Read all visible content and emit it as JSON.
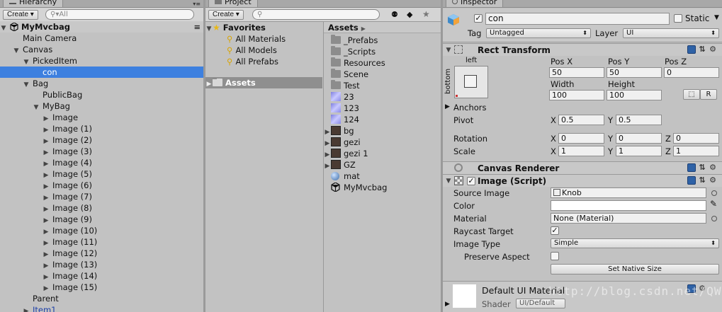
{
  "colors": {
    "selection": "#3d80df",
    "panel": "#c2c2c2",
    "book_icon": "#2f62a6"
  },
  "hierarchy": {
    "tab": "Hierarchy",
    "create": "Create",
    "search_placeholder": "All",
    "scene": "MyMvcbag",
    "items": [
      {
        "label": "Main Camera",
        "indent": 1,
        "arrow": ""
      },
      {
        "label": "Canvas",
        "indent": 1,
        "arrow": "▼"
      },
      {
        "label": "PickedItem",
        "indent": 2,
        "arrow": "▼"
      },
      {
        "label": "con",
        "indent": 3,
        "arrow": "",
        "selected": true
      },
      {
        "label": "Bag",
        "indent": 2,
        "arrow": "▼"
      },
      {
        "label": "PublicBag",
        "indent": 3,
        "arrow": ""
      },
      {
        "label": "MyBag",
        "indent": 3,
        "arrow": "▼"
      },
      {
        "label": "Image",
        "indent": 4,
        "arrow": "▶"
      },
      {
        "label": "Image (1)",
        "indent": 4,
        "arrow": "▶"
      },
      {
        "label": "Image (2)",
        "indent": 4,
        "arrow": "▶"
      },
      {
        "label": "Image (3)",
        "indent": 4,
        "arrow": "▶"
      },
      {
        "label": "Image (4)",
        "indent": 4,
        "arrow": "▶"
      },
      {
        "label": "Image (5)",
        "indent": 4,
        "arrow": "▶"
      },
      {
        "label": "Image (6)",
        "indent": 4,
        "arrow": "▶"
      },
      {
        "label": "Image (7)",
        "indent": 4,
        "arrow": "▶"
      },
      {
        "label": "Image (8)",
        "indent": 4,
        "arrow": "▶"
      },
      {
        "label": "Image (9)",
        "indent": 4,
        "arrow": "▶"
      },
      {
        "label": "Image (10)",
        "indent": 4,
        "arrow": "▶"
      },
      {
        "label": "Image (11)",
        "indent": 4,
        "arrow": "▶"
      },
      {
        "label": "Image (12)",
        "indent": 4,
        "arrow": "▶"
      },
      {
        "label": "Image (13)",
        "indent": 4,
        "arrow": "▶"
      },
      {
        "label": "Image (14)",
        "indent": 4,
        "arrow": "▶"
      },
      {
        "label": "Image (15)",
        "indent": 4,
        "arrow": "▶"
      },
      {
        "label": "Parent",
        "indent": 2,
        "arrow": ""
      },
      {
        "label": "Item1",
        "indent": 2,
        "arrow": "▶",
        "prefab": true
      }
    ]
  },
  "project": {
    "tab": "Project",
    "create": "Create",
    "favorites_label": "Favorites",
    "favorites": [
      "All Materials",
      "All Models",
      "All Prefabs"
    ],
    "assets_left_label": "Assets",
    "breadcrumb": "Assets",
    "assets": [
      {
        "label": "_Prefabs",
        "icon": "folder-icon",
        "arrow": ""
      },
      {
        "label": "_Scripts",
        "icon": "folder-icon",
        "arrow": ""
      },
      {
        "label": "Resources",
        "icon": "folder-icon",
        "arrow": ""
      },
      {
        "label": "Scene",
        "icon": "folder-icon",
        "arrow": ""
      },
      {
        "label": "Test",
        "icon": "folder-icon",
        "arrow": ""
      },
      {
        "label": "23",
        "icon": "texture-icon",
        "arrow": ""
      },
      {
        "label": "123",
        "icon": "texture-icon",
        "arrow": ""
      },
      {
        "label": "124",
        "icon": "texture-icon",
        "arrow": ""
      },
      {
        "label": "bg",
        "icon": "sprite-icon",
        "arrow": "▶"
      },
      {
        "label": "gezi",
        "icon": "sprite-icon",
        "arrow": "▶"
      },
      {
        "label": "gezi 1",
        "icon": "sprite-icon",
        "arrow": "▶"
      },
      {
        "label": "GZ",
        "icon": "sprite-icon",
        "arrow": "▶"
      },
      {
        "label": "mat",
        "icon": "material-icon",
        "arrow": ""
      },
      {
        "label": "MyMvcbag",
        "icon": "unity-scene-icon",
        "arrow": ""
      }
    ]
  },
  "inspector": {
    "tab": "Inspector",
    "name": "con",
    "static_label": "Static",
    "tag_label": "Tag",
    "tag": "Untagged",
    "layer_label": "Layer",
    "layer": "UI",
    "rect": {
      "title": "Rect Transform",
      "anchor_left": "left",
      "anchor_bottom": "bottom",
      "posx_label": "Pos X",
      "posy_label": "Pos Y",
      "posz_label": "Pos Z",
      "posx": "50",
      "posy": "50",
      "posz": "0",
      "width_label": "Width",
      "height_label": "Height",
      "width": "100",
      "height": "100",
      "r_button": "R",
      "anchors_label": "Anchors",
      "pivot_label": "Pivot",
      "pivot_x": "0.5",
      "pivot_y": "0.5",
      "rotation_label": "Rotation",
      "rot_x": "0",
      "rot_y": "0",
      "rot_z": "0",
      "scale_label": "Scale",
      "scale_x": "1",
      "scale_y": "1",
      "scale_z": "1",
      "x": "X",
      "y": "Y",
      "z": "Z"
    },
    "canvas_renderer": "Canvas Renderer",
    "image": {
      "title": "Image (Script)",
      "source_label": "Source Image",
      "source": "Knob",
      "color_label": "Color",
      "material_label": "Material",
      "material": "None (Material)",
      "raycast_label": "Raycast Target",
      "type_label": "Image Type",
      "type": "Simple",
      "preserve_label": "Preserve Aspect",
      "native_button": "Set Native Size"
    },
    "material_panel": {
      "title": "Default UI Material",
      "shader_label": "Shader",
      "shader": "UI/Default"
    }
  },
  "watermark": "http://blog.csdn.net/QWBin"
}
